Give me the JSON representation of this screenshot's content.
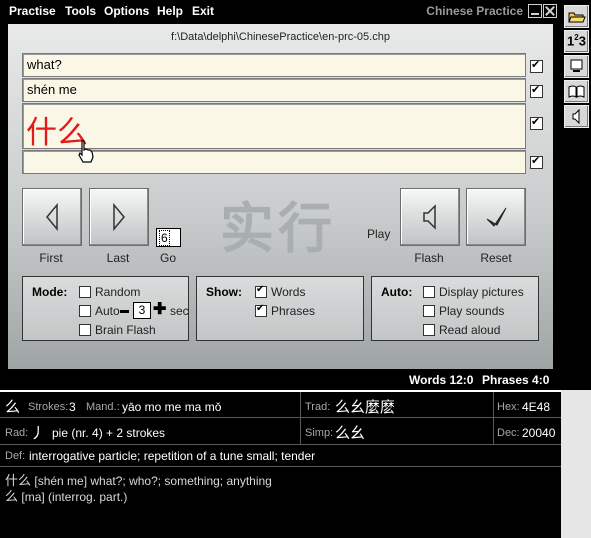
{
  "menu": [
    "Practise",
    "Tools",
    "Options",
    "Help",
    "Exit"
  ],
  "app_title": "Chinese Practice",
  "file_path": "f:\\Data\\delphi\\ChinesePractice\\en-prc-05.chp",
  "fields": {
    "english": "what?",
    "pinyin": "shén me",
    "hanzi": "什么",
    "extra": ""
  },
  "field_checks": [
    true,
    true,
    true,
    true
  ],
  "buttons": {
    "first": "First",
    "last": "Last",
    "go": "Go",
    "go_value": "6",
    "play": "Play",
    "flash": "Flash",
    "reset": "Reset"
  },
  "watermark": "实行",
  "mode": {
    "title": "Mode:",
    "random": "Random",
    "random_checked": false,
    "auto": "Auto",
    "auto_checked": false,
    "auto_seconds": "3",
    "sec": "sec",
    "brain_flash": "Brain Flash",
    "brain_flash_checked": false
  },
  "show": {
    "title": "Show:",
    "words": "Words",
    "words_checked": true,
    "phrases": "Phrases",
    "phrases_checked": true
  },
  "auto": {
    "title": "Auto:",
    "display_pictures": "Display pictures",
    "play_sounds": "Play sounds",
    "read_aloud": "Read aloud"
  },
  "status": {
    "words": "Words 12:0",
    "phrases": "Phrases 4:0"
  },
  "toolbar": [
    "open-folder-icon",
    "numbers-icon",
    "monitor-icon",
    "book-icon",
    "speaker-icon"
  ],
  "info": {
    "char": "么",
    "strokes_label": "Strokes:",
    "strokes": "3",
    "mand_label": "Mand.:",
    "mand": "yāo mo me ma mǒ",
    "trad_label": "Trad:",
    "trad": "么幺麼麽",
    "hex_label": "Hex:",
    "hex": "4E48",
    "rad_label": "Rad:",
    "rad_char": "丿",
    "rad": "pie (nr. 4) + 2 strokes",
    "simp_label": "Simp:",
    "simp": "么幺",
    "dec_label": "Dec:",
    "dec": "20040",
    "def_label": "Def:",
    "def": "interrogative particle; repetition of a tune small; tender",
    "phrase1_hanzi": "什么",
    "phrase1": "[shén me] what?; who?; something; anything",
    "phrase2_hanzi": "么",
    "phrase2": "[ma] (interrog. part.)"
  }
}
